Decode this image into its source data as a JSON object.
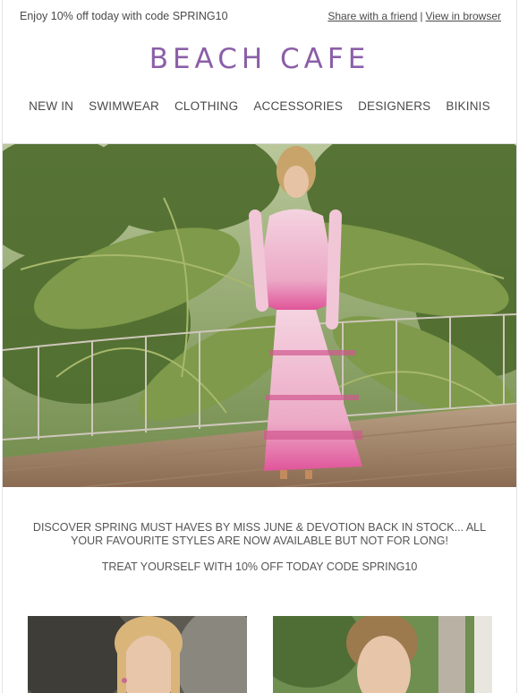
{
  "header": {
    "promo_text": "Enjoy 10% off today with code SPRING10",
    "share_link": "Share with a friend",
    "separator": "|",
    "browser_link": "View in browser"
  },
  "logo": {
    "text": "BEACH CAFE"
  },
  "nav": {
    "items": [
      {
        "label": "NEW IN"
      },
      {
        "label": "SWIMWEAR"
      },
      {
        "label": "CLOTHING"
      },
      {
        "label": "ACCESSORIES"
      },
      {
        "label": "DESIGNERS"
      },
      {
        "label": "BIKINIS"
      }
    ]
  },
  "body": {
    "announcement": "DISCOVER SPRING MUST HAVES BY MISS JUNE & DEVOTION BACK IN STOCK...  ALL YOUR FAVOURITE STYLES ARE NOW AVAILABLE BUT NOT FOR LONG!",
    "offer": "TREAT YOURSELF WITH 10% OFF TODAY CODE SPRING10"
  },
  "colors": {
    "brand": "#8b5fa8",
    "text": "#4a4a4a",
    "dress_pink": "#e98fb7"
  }
}
